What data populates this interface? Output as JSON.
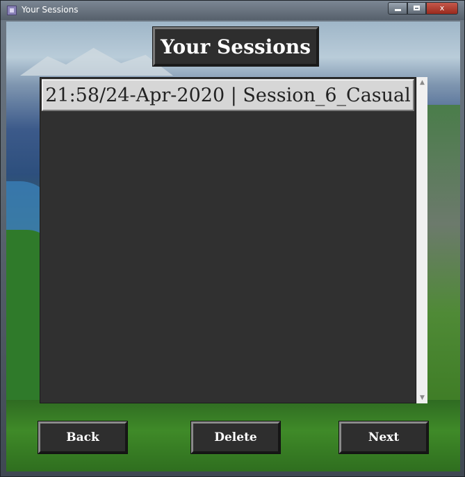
{
  "window": {
    "title": "Your Sessions",
    "controls": {
      "minimize_icon": "minimize-icon",
      "maximize_icon": "maximize-icon",
      "close_label": "x"
    }
  },
  "header": {
    "title": "Your Sessions"
  },
  "sessions": {
    "items": [
      {
        "label": "21:58/24-Apr-2020 | Session_6_Casual"
      }
    ]
  },
  "buttons": {
    "back": "Back",
    "delete": "Delete",
    "next": "Next"
  },
  "scrollbar": {
    "up_glyph": "▲",
    "down_glyph": "▼"
  }
}
